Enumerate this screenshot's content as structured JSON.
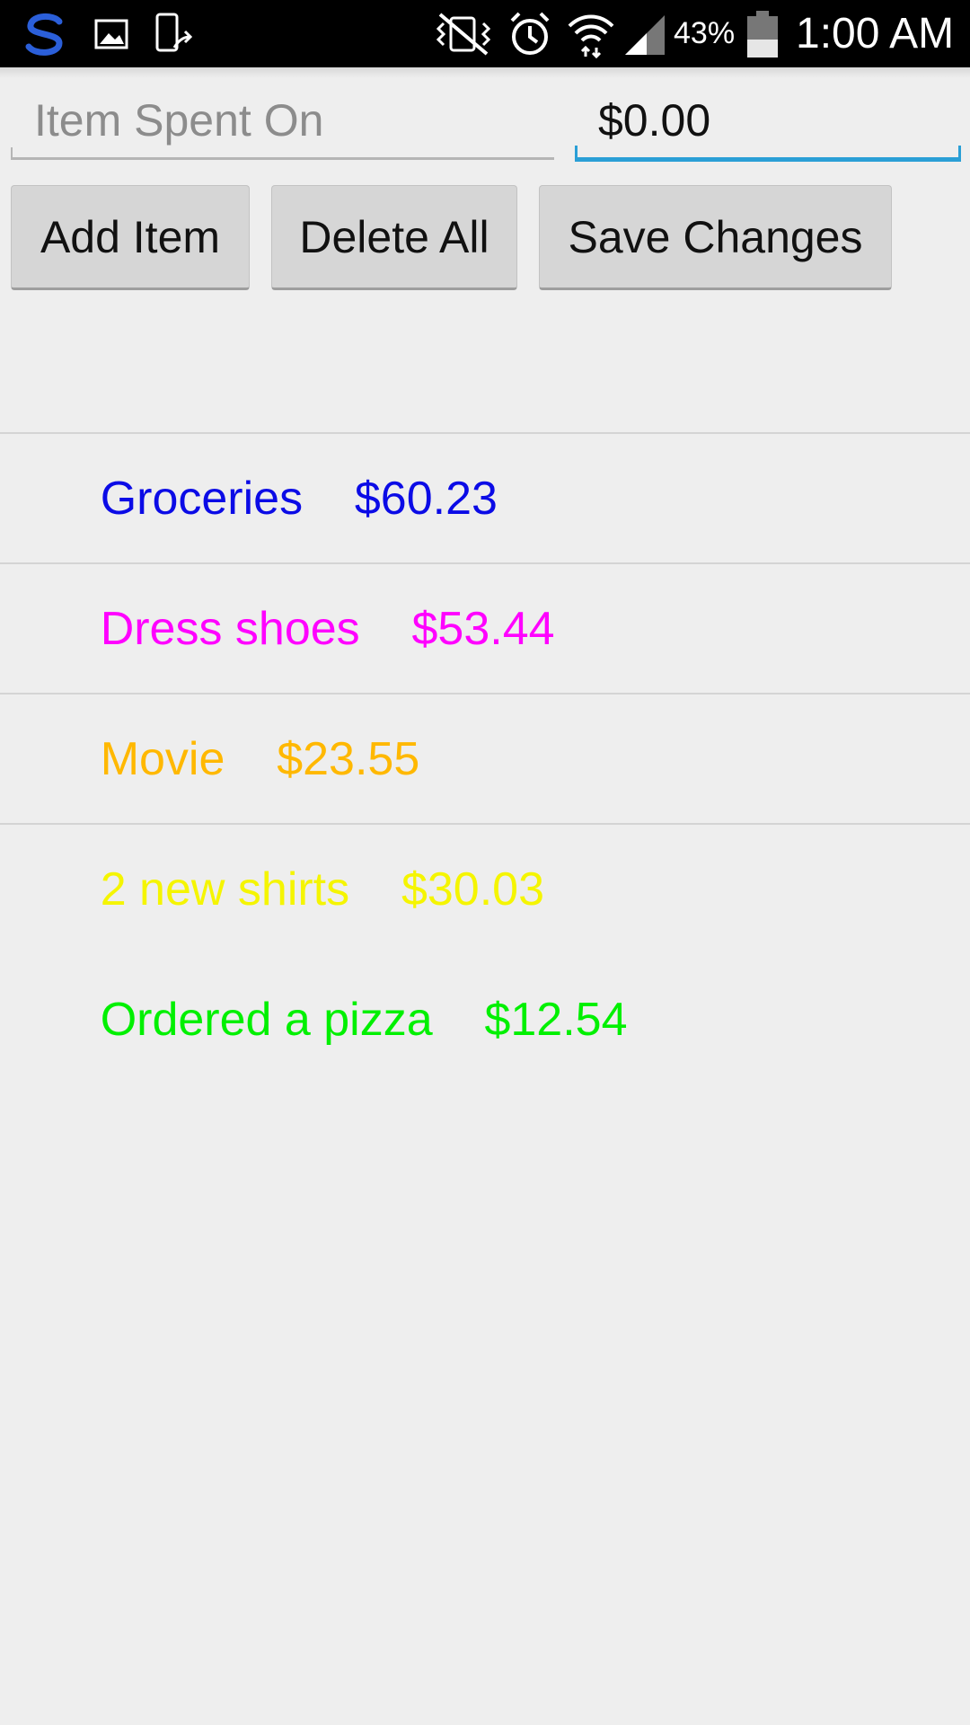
{
  "status_bar": {
    "battery_percent": "43%",
    "time": "1:00 AM",
    "icons": [
      "s-logo-icon",
      "gallery-icon",
      "screenshot-icon",
      "vibrate-icon",
      "alarm-icon",
      "wifi-icon",
      "signal-icon",
      "battery-icon"
    ]
  },
  "form": {
    "item_placeholder": "Item Spent On",
    "amount_value": "$0.00"
  },
  "buttons": {
    "add": "Add Item",
    "delete_all": "Delete All",
    "save": "Save Changes"
  },
  "expenses": [
    {
      "item": "Groceries",
      "amount": "$60.23",
      "color": "#0b0be6"
    },
    {
      "item": "Dress shoes",
      "amount": "$53.44",
      "color": "#ff00ff"
    },
    {
      "item": "Movie",
      "amount": "$23.55",
      "color": "#ffb800"
    },
    {
      "item": "2 new shirts",
      "amount": "$30.03",
      "color": "#f5f500"
    },
    {
      "item": "Ordered a pizza",
      "amount": "$12.54",
      "color": "#00f000"
    }
  ]
}
